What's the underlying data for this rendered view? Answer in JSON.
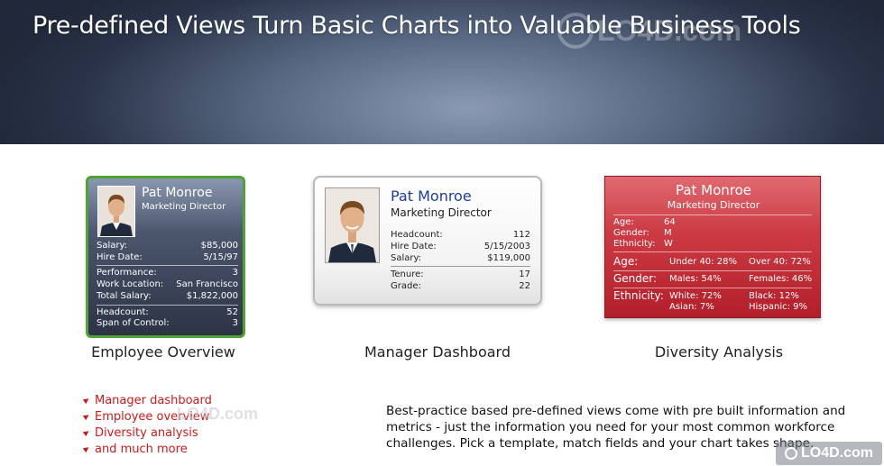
{
  "hero": {
    "title": "Pre-defined Views Turn Basic Charts into Valuable Business Tools"
  },
  "watermark": {
    "text": "LO4D.com"
  },
  "employee_overview": {
    "name": "Pat Monroe",
    "title": "Marketing Director",
    "group1": [
      {
        "label": "Salary:",
        "value": "$85,000"
      },
      {
        "label": "Hire Date:",
        "value": "5/15/97"
      }
    ],
    "group2": [
      {
        "label": "Performance:",
        "value": "3"
      },
      {
        "label": "Work Location:",
        "value": "San Francisco"
      },
      {
        "label": "Total Salary:",
        "value": "$1,822,000"
      }
    ],
    "group3": [
      {
        "label": "Headcount:",
        "value": "52"
      },
      {
        "label": "Span of Control:",
        "value": "3"
      }
    ],
    "caption": "Employee Overview",
    "border_color": "#4ea431"
  },
  "manager_dashboard": {
    "name": "Pat Monroe",
    "title": "Marketing Director",
    "group1": [
      {
        "label": "Headcount:",
        "value": "112"
      },
      {
        "label": "Hire Date:",
        "value": "5/15/2003"
      },
      {
        "label": "Salary:",
        "value": "$119,000"
      }
    ],
    "group2": [
      {
        "label": "Tenure:",
        "value": "17"
      },
      {
        "label": "Grade:",
        "value": "22"
      }
    ],
    "caption": "Manager Dashboard",
    "name_color": "#203f8c"
  },
  "diversity_analysis": {
    "name": "Pat Monroe",
    "title": "Marketing Director",
    "basic": [
      {
        "label": "Age:",
        "value": "64"
      },
      {
        "label": "Gender:",
        "value": "M"
      },
      {
        "label": "Ethnicity:",
        "value": "W"
      }
    ],
    "age": {
      "label": "Age:",
      "c1": "Under 40: 28%",
      "c2": "Over 40: 72%"
    },
    "gender": {
      "label": "Gender:",
      "c1": "Males: 54%",
      "c2": "Females: 46%"
    },
    "ethnicity": {
      "label": "Ethnicity:",
      "c1a": "White: 72%",
      "c2a": "Black: 12%",
      "c1b": "Asian: 7%",
      "c2b": "Hispanic: 9%"
    },
    "caption": "Diversity Analysis",
    "card_color": "#c42e38"
  },
  "bullets": [
    "Manager dashboard",
    "Employee overview",
    "Diversity analysis",
    "and much more"
  ],
  "bullet_color": "#cc1a1a",
  "description": "Best-practice based pre-defined views come with pre built information and metrics - just the information you need for your most common workforce challenges. Pick a template, match fields and your chart takes shape."
}
